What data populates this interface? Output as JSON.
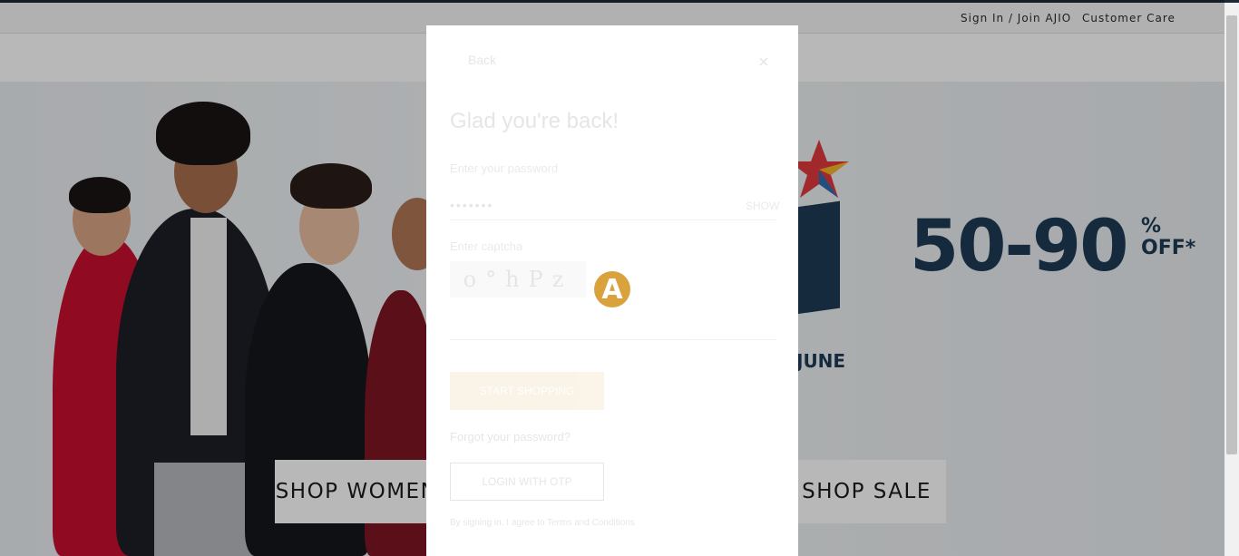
{
  "header": {
    "sign_in_label": "Sign In / Join AJIO",
    "customer_care_label": "Customer Care"
  },
  "promo": {
    "discount": "50-90",
    "percent_sign": "%",
    "off_label": "OFF*",
    "date_fragment": "JUNE"
  },
  "hero": {
    "shop_women_label": "SHOP WOMEN",
    "shop_sale_label": "SHOP SALE"
  },
  "login_modal": {
    "back_label": "Back",
    "close_symbol": "×",
    "title": "Glad you're back!",
    "password_label": "Enter your password",
    "password_value": "•••••••",
    "show_label": "SHOW",
    "captcha_label": "Enter captcha",
    "captcha_text": "o°hPz",
    "submit_label": "START SHOPPING",
    "forgot_label": "Forgot your password?",
    "otp_label": "LOGIN WITH OTP",
    "terms_text": "By signing in, I agree to Terms and Conditions"
  },
  "loader": {
    "icon_letter": "A",
    "color": "#d9a23d"
  },
  "colors": {
    "brand_gold": "#d5a249",
    "promo_navy": "#1f3b55",
    "top_bar": "#1d2a36"
  }
}
